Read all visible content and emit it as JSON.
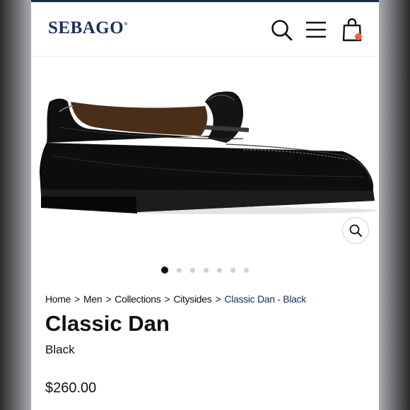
{
  "header": {
    "brand": "SEBAGO",
    "brand_mark": "®",
    "icons": [
      "search-icon",
      "menu-icon",
      "cart-icon"
    ],
    "cart_badge_color": "#f0643c"
  },
  "gallery": {
    "image_count": 7,
    "active_index": 0
  },
  "breadcrumb": {
    "items": [
      "Home",
      "Men",
      "Collections",
      "Citysides"
    ],
    "current": "Classic Dan - Black",
    "separator": ">"
  },
  "product": {
    "title": "Classic Dan",
    "color": "Black",
    "price": "$260.00"
  },
  "colors": {
    "brand_navy": "#1a2e5c",
    "accent": "#f0643c"
  }
}
